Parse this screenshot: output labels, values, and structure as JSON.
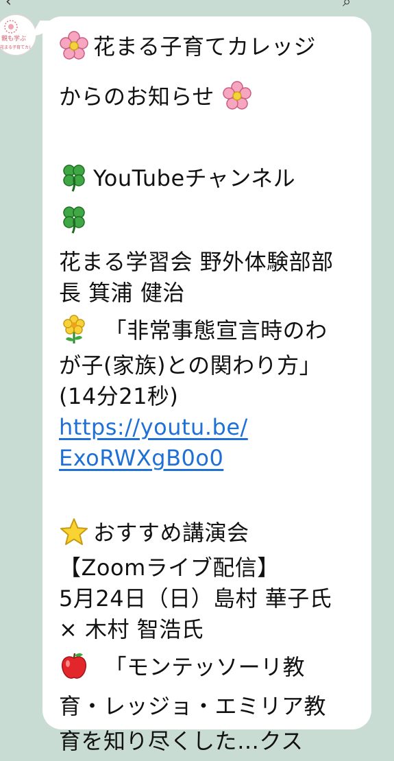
{
  "sender": {
    "logo_text": "親も学ぶ",
    "logo_sub": "花まる子育てカレッジ"
  },
  "message": {
    "lines": [
      "花まる子育てカレッジ",
      "からのお知らせ",
      "YouTubeチャンネル",
      "花まる学習会 野外体験部部",
      "長 箕浦 健治",
      "「非常事態宣言時のわ",
      "が子(家族)との関わり方」",
      "(14分21秒)",
      "https://youtu.be/",
      "ExoRWXgB0o0",
      "おすすめ講演会",
      "【Zoomライブ配信】",
      "5月24日（日）島村 華子氏",
      "× 木村 智浩氏",
      "「モンテッソーリ教",
      "育・レッジョ・エミリア教",
      "育を知り尽くした…クス"
    ]
  },
  "colors": {
    "background": "#c8dcd3",
    "bubble": "#ffffff",
    "link": "#1e70d6"
  },
  "icons": [
    "cherry-blossom-icon",
    "four-leaf-clover-icon",
    "yellow-flower-icon",
    "star-icon",
    "apple-icon"
  ]
}
